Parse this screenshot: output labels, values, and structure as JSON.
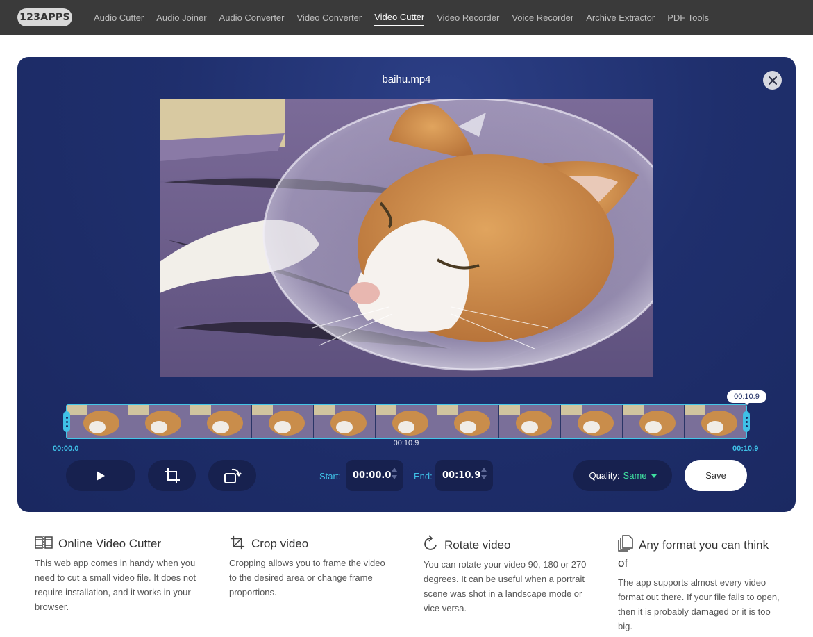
{
  "nav": {
    "logo": "123APPS",
    "items": [
      {
        "label": "Audio Cutter",
        "active": false
      },
      {
        "label": "Audio Joiner",
        "active": false
      },
      {
        "label": "Audio Converter",
        "active": false
      },
      {
        "label": "Video Converter",
        "active": false
      },
      {
        "label": "Video Cutter",
        "active": true
      },
      {
        "label": "Video Recorder",
        "active": false
      },
      {
        "label": "Voice Recorder",
        "active": false
      },
      {
        "label": "Archive Extractor",
        "active": false
      },
      {
        "label": "PDF Tools",
        "active": false
      }
    ]
  },
  "editor": {
    "filename": "baihu.mp4",
    "timeline": {
      "bubble_time": "00:10.9",
      "center_time": "00:10.9",
      "start_time": "00:00.0",
      "end_time": "00:10.9"
    },
    "controls": {
      "start_label": "Start:",
      "start_value": "00:00.0",
      "end_label": "End:",
      "end_value": "00:10.9",
      "quality_label": "Quality:",
      "quality_value": "Same",
      "save_label": "Save"
    }
  },
  "features": [
    {
      "icon": "film-cut-icon",
      "title": "Online Video Cutter",
      "text": "This web app comes in handy when you need to cut a small video file. It does not require installation, and it works in your browser."
    },
    {
      "icon": "crop-icon",
      "title": "Crop video",
      "text": "Cropping allows you to frame the video to the desired area or change frame proportions."
    },
    {
      "icon": "rotate-icon",
      "title": "Rotate video",
      "text": "You can rotate your video 90, 180 or 270 degrees. It can be useful when a portrait scene was shot in a landscape mode or vice versa."
    },
    {
      "icon": "files-icon",
      "title": "Any format you can think of",
      "text": "The app supports almost every video format out there. If your file fails to open, then it is probably damaged or it is too big."
    }
  ],
  "colors": {
    "topbar": "#3a3a3a",
    "panel": "#1f2f6d",
    "accent": "#3fc0e6",
    "quality": "#3fe0a0"
  }
}
